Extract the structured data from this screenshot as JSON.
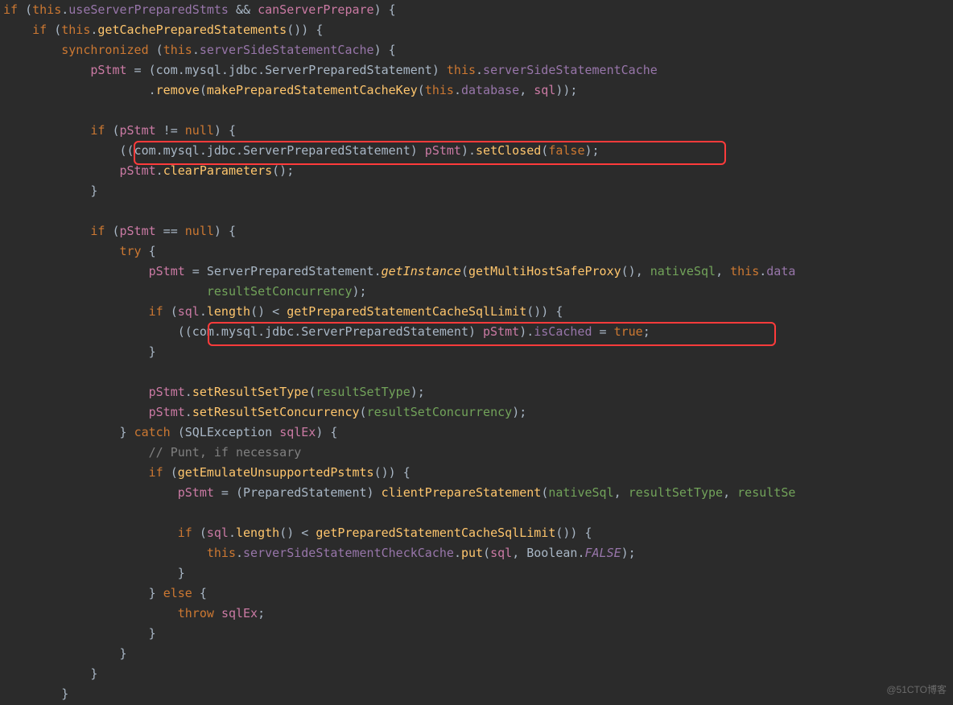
{
  "watermark": "@51CTO博客",
  "highlights": [
    {
      "id": "hl1"
    },
    {
      "id": "hl2"
    }
  ],
  "code_lines": [
    [
      [
        "k",
        "if"
      ],
      [
        "s",
        " ("
      ],
      [
        "k",
        "this"
      ],
      [
        "s",
        "."
      ],
      [
        "f",
        "useServerPreparedStmts"
      ],
      [
        "s",
        " && "
      ],
      [
        "lv",
        "canServerPrepare"
      ],
      [
        "s",
        ") {"
      ]
    ],
    [
      [
        "s",
        "    "
      ],
      [
        "k",
        "if"
      ],
      [
        "s",
        " ("
      ],
      [
        "k",
        "this"
      ],
      [
        "s",
        "."
      ],
      [
        "fn",
        "getCachePreparedStatements"
      ],
      [
        "s",
        "()) {"
      ]
    ],
    [
      [
        "s",
        "        "
      ],
      [
        "k",
        "synchronized"
      ],
      [
        "s",
        " ("
      ],
      [
        "k",
        "this"
      ],
      [
        "s",
        "."
      ],
      [
        "f",
        "serverSideStatementCache"
      ],
      [
        "s",
        ") {"
      ]
    ],
    [
      [
        "s",
        "            "
      ],
      [
        "lv",
        "pStmt"
      ],
      [
        "s",
        " = (com.mysql.jdbc.ServerPreparedStatement) "
      ],
      [
        "k",
        "this"
      ],
      [
        "s",
        "."
      ],
      [
        "f",
        "serverSideStatementCache"
      ]
    ],
    [
      [
        "s",
        "                    ."
      ],
      [
        "fn",
        "remove"
      ],
      [
        "s",
        "("
      ],
      [
        "fn",
        "makePreparedStatementCacheKey"
      ],
      [
        "s",
        "("
      ],
      [
        "k",
        "this"
      ],
      [
        "s",
        "."
      ],
      [
        "f",
        "database"
      ],
      [
        "s",
        ", "
      ],
      [
        "lv",
        "sql"
      ],
      [
        "s",
        "));"
      ]
    ],
    [
      [
        "s",
        ""
      ]
    ],
    [
      [
        "s",
        "            "
      ],
      [
        "k",
        "if"
      ],
      [
        "s",
        " ("
      ],
      [
        "lv",
        "pStmt"
      ],
      [
        "s",
        " != "
      ],
      [
        "k",
        "null"
      ],
      [
        "s",
        ") {"
      ]
    ],
    [
      [
        "s",
        "                ((com.mysql.jdbc.ServerPreparedStatement) "
      ],
      [
        "lv",
        "pStmt"
      ],
      [
        "s",
        ")."
      ],
      [
        "fn",
        "setClosed"
      ],
      [
        "s",
        "("
      ],
      [
        "k",
        "false"
      ],
      [
        "s",
        ");"
      ]
    ],
    [
      [
        "s",
        "                "
      ],
      [
        "lv",
        "pStmt"
      ],
      [
        "s",
        "."
      ],
      [
        "fn",
        "clearParameters"
      ],
      [
        "s",
        "();"
      ]
    ],
    [
      [
        "s",
        "            }"
      ]
    ],
    [
      [
        "s",
        ""
      ]
    ],
    [
      [
        "s",
        "            "
      ],
      [
        "k",
        "if"
      ],
      [
        "s",
        " ("
      ],
      [
        "lv",
        "pStmt"
      ],
      [
        "s",
        " == "
      ],
      [
        "k",
        "null"
      ],
      [
        "s",
        ") {"
      ]
    ],
    [
      [
        "s",
        "                "
      ],
      [
        "k",
        "try"
      ],
      [
        "s",
        " {"
      ]
    ],
    [
      [
        "s",
        "                    "
      ],
      [
        "lv",
        "pStmt"
      ],
      [
        "s",
        " = ServerPreparedStatement."
      ],
      [
        "fn it",
        "getInstance"
      ],
      [
        "s",
        "("
      ],
      [
        "fn",
        "getMultiHostSafeProxy"
      ],
      [
        "s",
        "(), "
      ],
      [
        "param",
        "nativeSql"
      ],
      [
        "s",
        ", "
      ],
      [
        "k",
        "this"
      ],
      [
        "s",
        "."
      ],
      [
        "f",
        "data"
      ]
    ],
    [
      [
        "s",
        "                            "
      ],
      [
        "param",
        "resultSetConcurrency"
      ],
      [
        "s",
        ");"
      ]
    ],
    [
      [
        "s",
        "                    "
      ],
      [
        "k",
        "if"
      ],
      [
        "s",
        " ("
      ],
      [
        "lv",
        "sql"
      ],
      [
        "s",
        "."
      ],
      [
        "fn",
        "length"
      ],
      [
        "s",
        "() < "
      ],
      [
        "fn",
        "getPreparedStatementCacheSqlLimit"
      ],
      [
        "s",
        "()) {"
      ]
    ],
    [
      [
        "s",
        "                        ((com.mysql.jdbc.ServerPreparedStatement) "
      ],
      [
        "lv",
        "pStmt"
      ],
      [
        "s",
        ")."
      ],
      [
        "f",
        "isCached"
      ],
      [
        "s",
        " = "
      ],
      [
        "k",
        "true"
      ],
      [
        "s",
        ";"
      ]
    ],
    [
      [
        "s",
        "                    }"
      ]
    ],
    [
      [
        "s",
        ""
      ]
    ],
    [
      [
        "s",
        "                    "
      ],
      [
        "lv",
        "pStmt"
      ],
      [
        "s",
        "."
      ],
      [
        "fn",
        "setResultSetType"
      ],
      [
        "s",
        "("
      ],
      [
        "param",
        "resultSetType"
      ],
      [
        "s",
        ");"
      ]
    ],
    [
      [
        "s",
        "                    "
      ],
      [
        "lv",
        "pStmt"
      ],
      [
        "s",
        "."
      ],
      [
        "fn",
        "setResultSetConcurrency"
      ],
      [
        "s",
        "("
      ],
      [
        "param",
        "resultSetConcurrency"
      ],
      [
        "s",
        ");"
      ]
    ],
    [
      [
        "s",
        "                } "
      ],
      [
        "k",
        "catch"
      ],
      [
        "s",
        " (SQLException "
      ],
      [
        "lv",
        "sqlEx"
      ],
      [
        "s",
        ") {"
      ]
    ],
    [
      [
        "s",
        "                    "
      ],
      [
        "cm",
        "// Punt, if necessary"
      ]
    ],
    [
      [
        "s",
        "                    "
      ],
      [
        "k",
        "if"
      ],
      [
        "s",
        " ("
      ],
      [
        "fn",
        "getEmulateUnsupportedPstmts"
      ],
      [
        "s",
        "()) {"
      ]
    ],
    [
      [
        "s",
        "                        "
      ],
      [
        "lv",
        "pStmt"
      ],
      [
        "s",
        " = (PreparedStatement) "
      ],
      [
        "fn",
        "clientPrepareStatement"
      ],
      [
        "s",
        "("
      ],
      [
        "param",
        "nativeSql"
      ],
      [
        "s",
        ", "
      ],
      [
        "param",
        "resultSetType"
      ],
      [
        "s",
        ", "
      ],
      [
        "param",
        "resultSe"
      ]
    ],
    [
      [
        "s",
        ""
      ]
    ],
    [
      [
        "s",
        "                        "
      ],
      [
        "k",
        "if"
      ],
      [
        "s",
        " ("
      ],
      [
        "lv",
        "sql"
      ],
      [
        "s",
        "."
      ],
      [
        "fn",
        "length"
      ],
      [
        "s",
        "() < "
      ],
      [
        "fn",
        "getPreparedStatementCacheSqlLimit"
      ],
      [
        "s",
        "()) {"
      ]
    ],
    [
      [
        "s",
        "                            "
      ],
      [
        "k",
        "this"
      ],
      [
        "s",
        "."
      ],
      [
        "f",
        "serverSideStatementCheckCache"
      ],
      [
        "s",
        "."
      ],
      [
        "fn",
        "put"
      ],
      [
        "s",
        "("
      ],
      [
        "lv",
        "sql"
      ],
      [
        "s",
        ", Boolean."
      ],
      [
        "f it",
        "FALSE"
      ],
      [
        "s",
        ");"
      ]
    ],
    [
      [
        "s",
        "                        }"
      ]
    ],
    [
      [
        "s",
        "                    } "
      ],
      [
        "k",
        "else"
      ],
      [
        "s",
        " {"
      ]
    ],
    [
      [
        "s",
        "                        "
      ],
      [
        "k",
        "throw"
      ],
      [
        "s",
        " "
      ],
      [
        "lv",
        "sqlEx"
      ],
      [
        "s",
        ";"
      ]
    ],
    [
      [
        "s",
        "                    }"
      ]
    ],
    [
      [
        "s",
        "                }"
      ]
    ],
    [
      [
        "s",
        "            }"
      ]
    ],
    [
      [
        "s",
        "        }"
      ]
    ]
  ]
}
